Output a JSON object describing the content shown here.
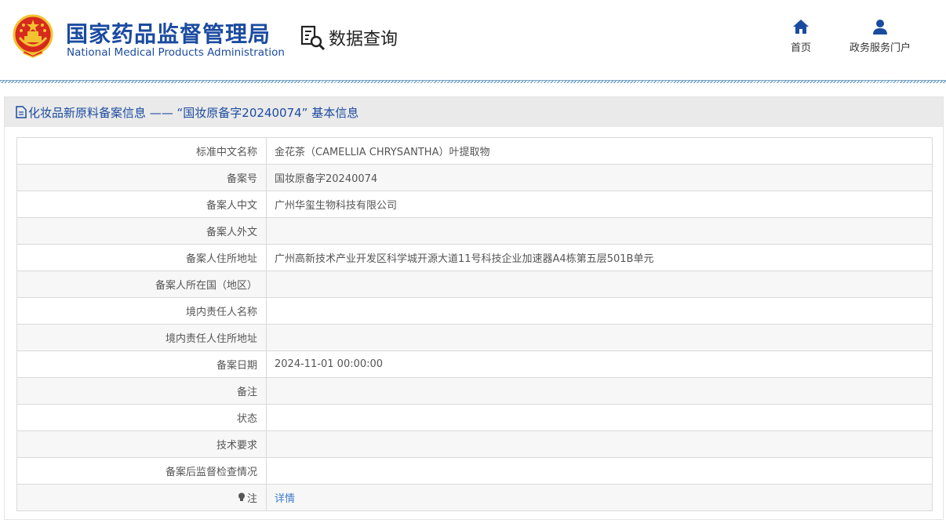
{
  "header": {
    "org_name_cn": "国家药品监督管理局",
    "org_name_en": "National Medical Products Administration",
    "query_label": "数据查询",
    "nav": {
      "home_label": "首页",
      "gov_service_label": "政务服务门户"
    }
  },
  "panel": {
    "title": "化妆品新原料备案信息 —— “国妆原备字20240074” 基本信息"
  },
  "record": {
    "rows": [
      {
        "label": "标准中文名称",
        "value": "金花茶（CAMELLIA CHRYSANTHA）叶提取物"
      },
      {
        "label": "备案号",
        "value": "国妆原备字20240074"
      },
      {
        "label": "备案人中文",
        "value": "广州华玺生物科技有限公司"
      },
      {
        "label": "备案人外文",
        "value": ""
      },
      {
        "label": "备案人住所地址",
        "value": "广州高新技术产业开发区科学城开源大道11号科技企业加速器A4栋第五层501B单元"
      },
      {
        "label": "备案人所在国（地区）",
        "value": ""
      },
      {
        "label": "境内责任人名称",
        "value": ""
      },
      {
        "label": "境内责任人住所地址",
        "value": ""
      },
      {
        "label": "备案日期",
        "value": "2024-11-01 00:00:00"
      },
      {
        "label": "备注",
        "value": ""
      },
      {
        "label": "状态",
        "value": ""
      },
      {
        "label": "技术要求",
        "value": ""
      },
      {
        "label": "备案后监督检查情况",
        "value": ""
      }
    ],
    "note_label": "注",
    "note_link": "详情"
  },
  "colors": {
    "brand_blue": "#1b4ba0",
    "link_blue": "#3a7bc8",
    "emblem_red": "#d62a1e",
    "emblem_gold": "#f2c230"
  },
  "icons": [
    "national-emblem",
    "search-doc-icon",
    "home-icon",
    "user-icon",
    "document-icon",
    "lightbulb-icon"
  ]
}
